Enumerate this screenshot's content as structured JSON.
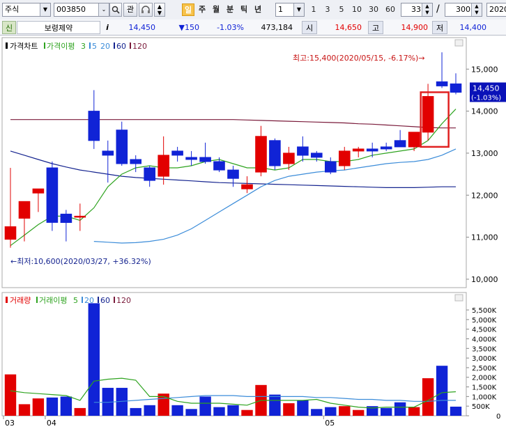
{
  "toolbar": {
    "market_label": "주식",
    "code_value": "003850",
    "icon_names": [
      "dropdown-icon",
      "search-icon",
      "headset-icon",
      "up-down-icon"
    ],
    "interest_label": "관",
    "period_tabs": [
      "일",
      "주",
      "월",
      "분",
      "틱",
      "년"
    ],
    "active_period": "일",
    "interval_value": "1",
    "quick_counts": [
      "1",
      "3",
      "5",
      "10",
      "30",
      "60"
    ],
    "count_value": "33",
    "count_separator": "/",
    "total_value": "300",
    "date_value": "2020"
  },
  "quote": {
    "tag": "신",
    "name": "보령제약",
    "info_label": "i",
    "price": "14,450",
    "change": "▼150",
    "change_rate": "-1.03%",
    "volume": "473,184",
    "open_label": "시",
    "open": "14,650",
    "high_label": "고",
    "high": "14,900",
    "low_label": "저",
    "low": "14,400"
  },
  "colors": {
    "up": "#e20000",
    "down": "#1023d6",
    "ma5": "#2ea31f",
    "ma20": "#3b8cd9",
    "ma60": "#14238f",
    "ma120": "#7a1a3a",
    "annotation": "#c81414",
    "highlight": "#e02020"
  },
  "price_panel": {
    "legend": [
      {
        "text": "가격차트",
        "color": "#000000"
      },
      {
        "text": "가격이평",
        "color": "#2ea31f"
      },
      {
        "text": "3",
        "color": "#2ea31f"
      },
      {
        "text": "5",
        "color": "#3b8cd9"
      },
      {
        "text": "20",
        "color": "#3b8cd9"
      },
      {
        "text": "60",
        "color": "#14238f"
      },
      {
        "text": "120",
        "color": "#7a1a3a"
      }
    ],
    "high_annotation": "최고:15,400(2020/05/15, -6.17%)→",
    "low_annotation": "←최저:10,600(2020/03/27, +36.32%)",
    "y_ticks": [
      "15,000",
      "14,000",
      "13,000",
      "12,000",
      "11,000",
      "10,000"
    ],
    "current_label": "14,450",
    "current_rate": "(-1.03%)"
  },
  "volume_panel": {
    "legend": [
      {
        "text": "거래량",
        "color": "#e20000"
      },
      {
        "text": "거래이평",
        "color": "#2ea31f"
      },
      {
        "text": "5",
        "color": "#2ea31f"
      },
      {
        "text": "20",
        "color": "#3b8cd9"
      },
      {
        "text": "60",
        "color": "#14238f"
      },
      {
        "text": "120",
        "color": "#7a1a3a"
      }
    ],
    "y_ticks": [
      "5,500K",
      "5,000K",
      "4,500K",
      "4,000K",
      "3,500K",
      "3,000K",
      "2,500K",
      "2,000K",
      "1,500K",
      "1,000K",
      "500K",
      "0"
    ],
    "x_labels": [
      {
        "index": 0,
        "text": "03"
      },
      {
        "index": 3,
        "text": "04"
      },
      {
        "index": 23,
        "text": "05"
      }
    ]
  },
  "chart_data": {
    "type": "candlestick",
    "price_ylim": [
      9800,
      15750
    ],
    "volume_ylim": [
      0,
      5900
    ],
    "volume_unit": "K",
    "candles": [
      {
        "o": 10950,
        "h": 12650,
        "l": 10750,
        "c": 11250,
        "v": 2150
      },
      {
        "o": 11450,
        "h": 11850,
        "l": 10900,
        "c": 11850,
        "v": 600
      },
      {
        "o": 12050,
        "h": 12150,
        "l": 11600,
        "c": 12150,
        "v": 900
      },
      {
        "o": 12650,
        "h": 12800,
        "l": 11150,
        "c": 11350,
        "v": 950
      },
      {
        "o": 11550,
        "h": 11650,
        "l": 10900,
        "c": 11350,
        "v": 1000
      },
      {
        "o": 11500,
        "h": 11800,
        "l": 11150,
        "c": 11500,
        "v": 400
      },
      {
        "o": 14000,
        "h": 14500,
        "l": 13100,
        "c": 13300,
        "v": 5850
      },
      {
        "o": 13050,
        "h": 13300,
        "l": 12300,
        "c": 12950,
        "v": 1450
      },
      {
        "o": 13550,
        "h": 13750,
        "l": 12700,
        "c": 12750,
        "v": 1450
      },
      {
        "o": 12850,
        "h": 12950,
        "l": 12550,
        "c": 12750,
        "v": 400
      },
      {
        "o": 12650,
        "h": 12700,
        "l": 12200,
        "c": 12350,
        "v": 550
      },
      {
        "o": 12450,
        "h": 13400,
        "l": 12250,
        "c": 12950,
        "v": 1150
      },
      {
        "o": 13050,
        "h": 13150,
        "l": 12800,
        "c": 12950,
        "v": 550
      },
      {
        "o": 12900,
        "h": 13050,
        "l": 12700,
        "c": 12850,
        "v": 350
      },
      {
        "o": 12900,
        "h": 13250,
        "l": 12750,
        "c": 12800,
        "v": 1000
      },
      {
        "o": 12800,
        "h": 12900,
        "l": 12550,
        "c": 12600,
        "v": 450
      },
      {
        "o": 12600,
        "h": 12700,
        "l": 12200,
        "c": 12400,
        "v": 550
      },
      {
        "o": 12150,
        "h": 12450,
        "l": 12050,
        "c": 12250,
        "v": 300
      },
      {
        "o": 12550,
        "h": 13650,
        "l": 12450,
        "c": 13400,
        "v": 1600
      },
      {
        "o": 13300,
        "h": 13350,
        "l": 12600,
        "c": 12700,
        "v": 1100
      },
      {
        "o": 12750,
        "h": 13150,
        "l": 12600,
        "c": 13000,
        "v": 650
      },
      {
        "o": 13150,
        "h": 13400,
        "l": 12800,
        "c": 12950,
        "v": 800
      },
      {
        "o": 13000,
        "h": 13050,
        "l": 12800,
        "c": 12900,
        "v": 350
      },
      {
        "o": 12800,
        "h": 12900,
        "l": 12500,
        "c": 12550,
        "v": 450
      },
      {
        "o": 12700,
        "h": 13150,
        "l": 12600,
        "c": 13050,
        "v": 500
      },
      {
        "o": 13050,
        "h": 13150,
        "l": 12900,
        "c": 13100,
        "v": 300
      },
      {
        "o": 13100,
        "h": 13250,
        "l": 12900,
        "c": 13050,
        "v": 500
      },
      {
        "o": 13150,
        "h": 13250,
        "l": 13050,
        "c": 13100,
        "v": 400
      },
      {
        "o": 13300,
        "h": 13550,
        "l": 13150,
        "c": 13150,
        "v": 700
      },
      {
        "o": 13150,
        "h": 13500,
        "l": 13050,
        "c": 13500,
        "v": 450
      },
      {
        "o": 13500,
        "h": 14650,
        "l": 13300,
        "c": 14350,
        "v": 1950
      },
      {
        "o": 14700,
        "h": 15400,
        "l": 14550,
        "c": 14600,
        "v": 2600
      },
      {
        "o": 14650,
        "h": 14900,
        "l": 14400,
        "c": 14450,
        "v": 473
      }
    ],
    "series": [
      {
        "name": "5",
        "values": [
          10800,
          11050,
          11300,
          11500,
          11500,
          11400,
          11700,
          12200,
          12500,
          12650,
          12700,
          12650,
          12650,
          12700,
          12800,
          12850,
          12750,
          12650,
          12650,
          12600,
          12650,
          12850,
          12850,
          12800,
          12800,
          12850,
          12950,
          13000,
          13050,
          13100,
          13300,
          13700,
          14050
        ]
      },
      {
        "name": "20",
        "values": [
          null,
          null,
          null,
          null,
          null,
          null,
          10900,
          10880,
          10860,
          10870,
          10900,
          10950,
          11050,
          11200,
          11400,
          11600,
          11800,
          12000,
          12200,
          12350,
          12450,
          12500,
          12550,
          12580,
          12600,
          12650,
          12700,
          12750,
          12780,
          12800,
          12850,
          12950,
          13100
        ]
      },
      {
        "name": "60",
        "values": [
          13050,
          12950,
          12850,
          12750,
          12670,
          12600,
          12550,
          12500,
          12450,
          12420,
          12400,
          12380,
          12360,
          12340,
          12320,
          12300,
          12290,
          12280,
          12270,
          12260,
          12250,
          12240,
          12230,
          12220,
          12210,
          12200,
          12190,
          12180,
          12180,
          12180,
          12190,
          12200,
          12200
        ]
      },
      {
        "name": "120",
        "values": [
          13800,
          13800,
          13800,
          13800,
          13800,
          13800,
          13800,
          13800,
          13800,
          13800,
          13800,
          13800,
          13800,
          13800,
          13800,
          13800,
          13800,
          13790,
          13780,
          13770,
          13760,
          13750,
          13740,
          13730,
          13720,
          13700,
          13690,
          13670,
          13650,
          13630,
          13610,
          13600,
          13600
        ]
      },
      {
        "name": "거래이평 5",
        "values": [
          1300,
          1200,
          1150,
          1100,
          1050,
          800,
          1800,
          1900,
          1950,
          1850,
          1000,
          1000,
          750,
          650,
          650,
          650,
          600,
          550,
          800,
          800,
          800,
          800,
          850,
          650,
          550,
          450,
          400,
          450,
          450,
          450,
          800,
          1200,
          1250
        ]
      },
      {
        "name": "거래이평 20",
        "values": [
          null,
          null,
          null,
          null,
          null,
          null,
          700,
          700,
          750,
          800,
          850,
          900,
          950,
          1000,
          1050,
          1050,
          1050,
          1000,
          1000,
          1000,
          1000,
          1000,
          950,
          950,
          900,
          850,
          850,
          800,
          800,
          750,
          750,
          800,
          800
        ]
      }
    ]
  }
}
